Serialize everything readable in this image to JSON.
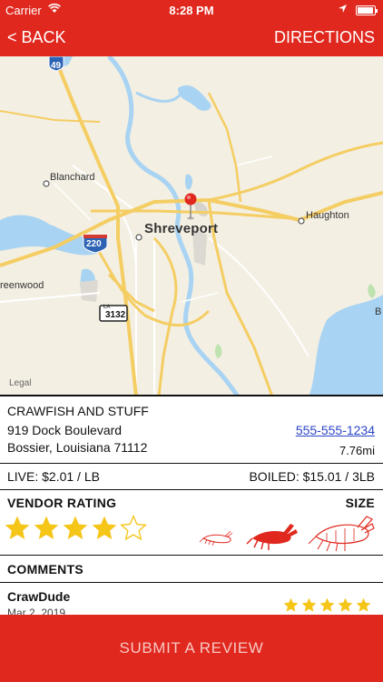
{
  "status_bar": {
    "carrier": "Carrier",
    "time": "8:28 PM"
  },
  "nav": {
    "back_label": "< BACK",
    "directions_label": "DIRECTIONS"
  },
  "map": {
    "highway_shield": "49",
    "interstate_shield": "220",
    "state_shield": "3132",
    "state_shield_top": "LA",
    "places": {
      "blanchard": "Blanchard",
      "shreveport": "Shreveport",
      "haughton": "Haughton",
      "greenwood": "reenwood",
      "bossier_edge": "B"
    },
    "legal": "Legal"
  },
  "vendor": {
    "name": "CRAWFISH AND STUFF",
    "address_line1": "919 Dock Boulevard",
    "address_line2": "Bossier, Louisiana 71112",
    "phone": "555-555-1234",
    "distance": "7.76mi"
  },
  "prices": {
    "live": "LIVE: $2.01 / LB",
    "boiled": "BOILED: $15.01 / 3LB"
  },
  "rating": {
    "label": "VENDOR RATING",
    "value": 4,
    "max": 5,
    "size_label": "SIZE"
  },
  "comments": {
    "label": "COMMENTS",
    "items": [
      {
        "author": "CrawDude",
        "date": "Mar 2, 2019",
        "rating": 5
      }
    ]
  },
  "submit_label": "SUBMIT A REVIEW",
  "colors": {
    "brand_red": "#e0281e",
    "star_gold": "#f5c518",
    "link_blue": "#2c46c7"
  }
}
